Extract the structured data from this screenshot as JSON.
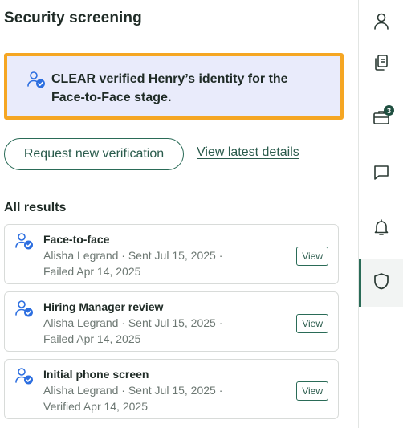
{
  "page": {
    "title": "Security screening"
  },
  "banner": {
    "text": "CLEAR verified Henry’s identity for the Face-to-Face stage.",
    "icon": "user-verified-icon",
    "highlight_color": "#f5a623",
    "background_color": "#e9ebfb"
  },
  "actions": {
    "request_label": "Request new verification",
    "view_latest_label": "View latest details"
  },
  "results": {
    "heading": "All results",
    "items": [
      {
        "title": "Face-to-face",
        "meta": "Alisha Legrand · Sent Jul 15, 2025 ·",
        "status": "Failed Apr 14, 2025",
        "view_label": "View",
        "icon": "user-verified-icon"
      },
      {
        "title": "Hiring Manager review",
        "meta": "Alisha Legrand · Sent Jul 15, 2025 ·",
        "status": "Failed Apr 14, 2025",
        "view_label": "View",
        "icon": "user-verified-icon"
      },
      {
        "title": "Initial phone screen",
        "meta": "Alisha Legrand · Sent Jul 15, 2025 ·",
        "status": "Verified Apr 14, 2025",
        "view_label": "View",
        "icon": "user-verified-icon"
      }
    ]
  },
  "rail": {
    "items": [
      {
        "icon": "person-icon"
      },
      {
        "icon": "documents-icon"
      },
      {
        "icon": "briefcase-icon",
        "badge": "3"
      },
      {
        "icon": "chat-icon"
      },
      {
        "icon": "bell-icon"
      },
      {
        "icon": "shield-icon",
        "active": true
      }
    ]
  },
  "colors": {
    "accent": "#2a6b57",
    "text": "#1f2b26",
    "muted_text": "#6c7772",
    "verified_blue": "#2d6fe0"
  }
}
